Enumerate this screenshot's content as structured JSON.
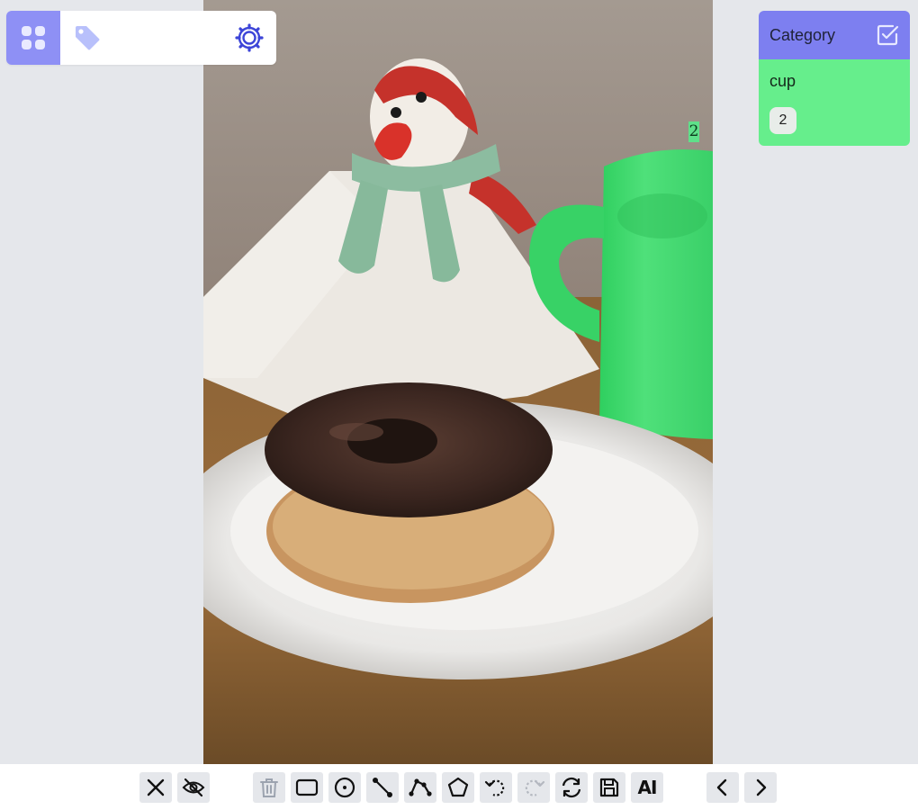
{
  "toolbar_top": {
    "menu_icon": "grid-icon",
    "tag_icon": "tag-icon",
    "settings_icon": "gear-icon"
  },
  "canvas": {
    "image": "photo of chocolate donut on plate with knitted penguin napkin holder and cup",
    "annotations": [
      {
        "label": "2",
        "category": "cup",
        "color": "#48e07a"
      }
    ]
  },
  "category_panel": {
    "title": "Category",
    "title_icon": "check-square-icon",
    "categories": [
      {
        "name": "cup",
        "count": "2",
        "color": "#66ee8c"
      }
    ]
  },
  "toolbar_bottom": {
    "buttons": [
      {
        "icon": "close-icon"
      },
      {
        "icon": "eye-off-icon"
      },
      {
        "icon": "trash-icon",
        "disabled": true
      },
      {
        "icon": "rectangle-icon"
      },
      {
        "icon": "circle-point-icon"
      },
      {
        "icon": "line-icon"
      },
      {
        "icon": "polyline-icon"
      },
      {
        "icon": "polygon-icon"
      },
      {
        "icon": "undo-icon"
      },
      {
        "icon": "redo-icon",
        "disabled": true
      },
      {
        "icon": "refresh-icon"
      },
      {
        "icon": "save-icon"
      },
      {
        "icon": "ai-icon",
        "label": "AI"
      },
      {
        "icon": "chevron-left-icon"
      },
      {
        "icon": "chevron-right-icon"
      }
    ]
  },
  "colors": {
    "accent": "#7d7ff0",
    "category_green": "#66ee8c",
    "background": "#e5e7eb"
  }
}
